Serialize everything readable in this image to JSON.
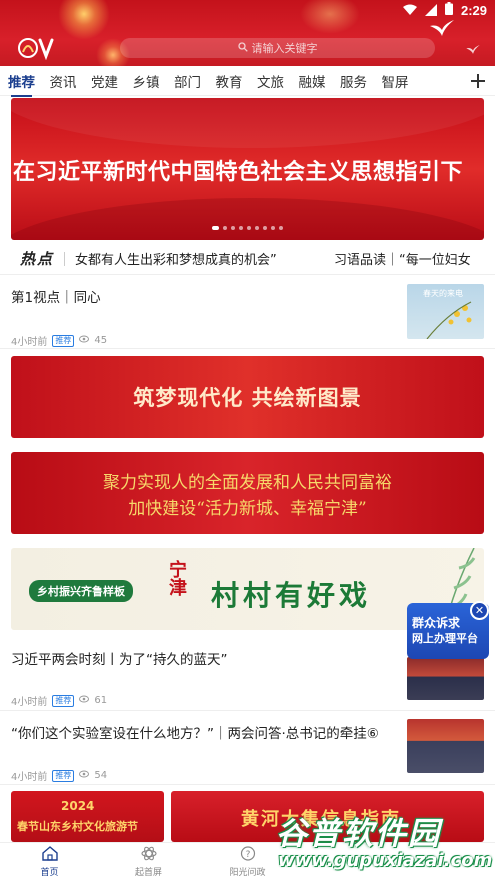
{
  "status": {
    "time": "2:29"
  },
  "header": {
    "search_placeholder": "请输入关键字"
  },
  "tabs": [
    "推荐",
    "资讯",
    "党建",
    "乡镇",
    "部门",
    "教育",
    "文旅",
    "融媒",
    "服务",
    "智屏"
  ],
  "banner": {
    "text": "在习近平新时代中国特色社会主义思想指引下",
    "dots": 9,
    "active_dot": 0
  },
  "hot": {
    "label": "热点",
    "items": [
      "女都有人生出彩和梦想成真的机会”",
      "习语品读｜“每一位妇女"
    ]
  },
  "articles": [
    {
      "title": "第1视点｜同心",
      "time": "4小时前",
      "badge": "推荐",
      "views": "45",
      "thumb_text": "春天的来电"
    },
    {
      "title": "习近平两会时刻丨为了“持久的蓝天”",
      "time": "4小时前",
      "badge": "推荐",
      "views": "61"
    },
    {
      "title": "“你们这个实验室设在什么地方？”｜两会问答·总书记的牵挂⑥",
      "time": "4小时前",
      "badge": "推荐",
      "views": "54"
    }
  ],
  "ads": {
    "ad1": "筑梦现代化  共绘新图景",
    "ad2_line1": "聚力实现人的全面发展和人民共同富裕",
    "ad2_line2": "加快建设“活力新城、幸福宁津”",
    "ad3_tag": "乡村振兴齐鲁样板",
    "ad3_brand": "宁津",
    "ad3_title": "村村有好戏",
    "bottom_left_year": "2024",
    "bottom_left_text": "春节山东乡村文化旅游节",
    "bottom_right_text": "黄河大集信息指南"
  },
  "floating": {
    "line1": "群众诉求",
    "line2": "网上办理平台"
  },
  "bottom_nav": [
    "首页",
    "起首屏",
    "阳光问政"
  ],
  "watermark": {
    "cn": "谷普软件园",
    "url": "www.gupuxiazai.com"
  },
  "colors": {
    "brand_red": "#d8202a",
    "accent_blue": "#1c3f8f"
  }
}
